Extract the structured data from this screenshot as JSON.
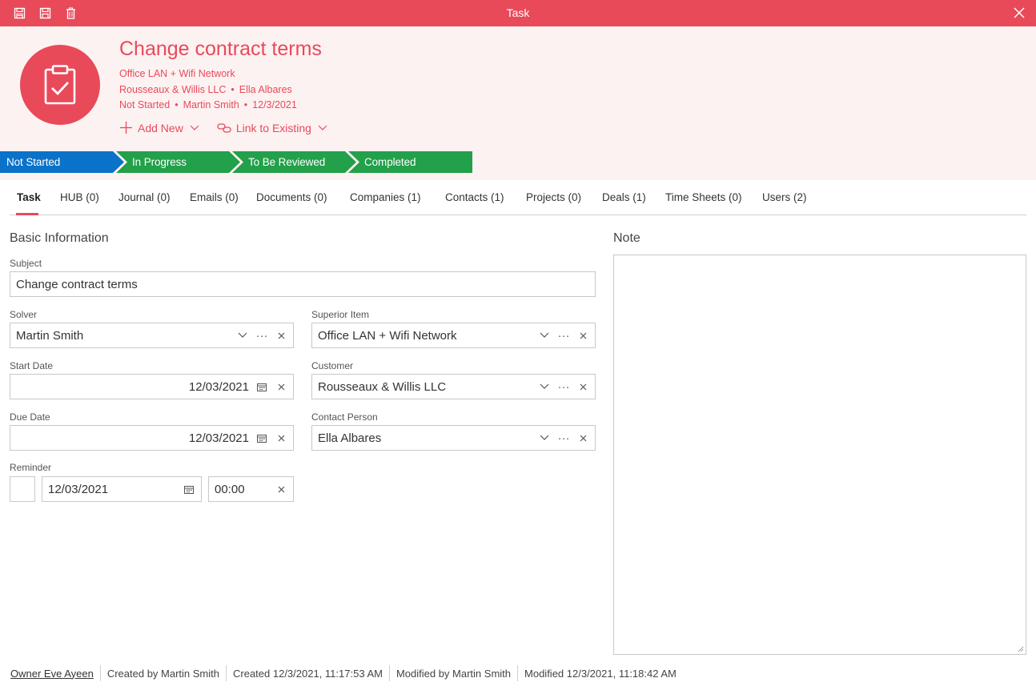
{
  "window": {
    "title": "Task",
    "toolbar_icons": [
      "save-close-icon",
      "save-icon",
      "trash-icon"
    ],
    "accent_color": "#e84a5a"
  },
  "header": {
    "title": "Change contract terms",
    "project": "Office LAN + Wifi Network",
    "company": "Rousseaux & Willis LLC",
    "contact": "Ella Albares",
    "status": "Not Started",
    "solver": "Martin Smith",
    "date": "12/3/2021",
    "dot": "•",
    "add_new": "Add New",
    "link_existing": "Link to Existing"
  },
  "stages": [
    {
      "label": "Not Started",
      "color": "#0a72c9"
    },
    {
      "label": "In Progress",
      "color": "#22a04a"
    },
    {
      "label": "To Be Reviewed",
      "color": "#22a04a"
    },
    {
      "label": "Completed",
      "color": "#22a04a"
    }
  ],
  "tabs": [
    {
      "label": "Task"
    },
    {
      "label": "HUB (0)"
    },
    {
      "label": "Journal (0)"
    },
    {
      "label": "Emails (0)"
    },
    {
      "label": "Documents (0)"
    },
    {
      "label": "Companies (1)"
    },
    {
      "label": "Contacts (1)"
    },
    {
      "label": "Projects (0)"
    },
    {
      "label": "Deals (1)"
    },
    {
      "label": "Time Sheets (0)"
    },
    {
      "label": "Users (2)"
    }
  ],
  "form": {
    "section_title": "Basic Information",
    "subject_label": "Subject",
    "subject_value": "Change contract terms",
    "solver_label": "Solver",
    "solver_value": "Martin Smith",
    "superior_label": "Superior Item",
    "superior_value": "Office LAN + Wifi Network",
    "start_label": "Start Date",
    "start_value": "12/03/2021",
    "customer_label": "Customer",
    "customer_value": "Rousseaux & Willis LLC",
    "due_label": "Due Date",
    "due_value": "12/03/2021",
    "contact_label": "Contact Person",
    "contact_value": "Ella Albares",
    "reminder_label": "Reminder",
    "reminder_date": "12/03/2021",
    "reminder_time": "00:00",
    "ellipsis": "···"
  },
  "note": {
    "title": "Note"
  },
  "footer": {
    "owner": "Owner Eve Ayeen",
    "created_by": "Created by Martin Smith",
    "created": "Created 12/3/2021, 11:17:53 AM",
    "modified_by": "Modified by Martin Smith",
    "modified": "Modified 12/3/2021, 11:18:42 AM"
  }
}
